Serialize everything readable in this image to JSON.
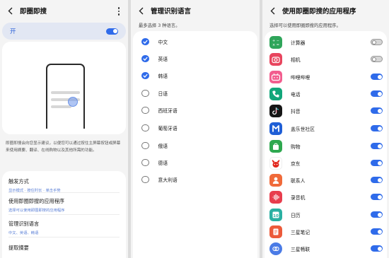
{
  "screen1": {
    "title": "即圈即搜",
    "master_toggle": {
      "label": "开",
      "on": true
    },
    "description": "即圈即搜会向您显示建议，以便您可以通过按住主屏幕按钮或屏幕来使用摘要、翻译、在线购物以及其他所需的功能。",
    "settings": [
      {
        "title": "触发方式",
        "subtitle": "显示模式 · 按住时长 · 单击手势"
      },
      {
        "title": "使用即圈即搜的应用程序",
        "subtitle": "选择可以使用即圈即搜的应用程序"
      },
      {
        "title": "管理识别语言",
        "subtitle": "中文、英语、韩语"
      },
      {
        "title": "提取摘要",
        "subtitle": ""
      }
    ]
  },
  "screen2": {
    "title": "管理识别语言",
    "subtitle": "最多选择 3 种语言。",
    "languages": [
      {
        "label": "中文",
        "checked": true
      },
      {
        "label": "英语",
        "checked": true
      },
      {
        "label": "韩语",
        "checked": true
      },
      {
        "label": "日语",
        "checked": false
      },
      {
        "label": "西班牙语",
        "checked": false
      },
      {
        "label": "葡萄牙语",
        "checked": false
      },
      {
        "label": "俄语",
        "checked": false
      },
      {
        "label": "德语",
        "checked": false
      },
      {
        "label": "意大利语",
        "checked": false
      }
    ]
  },
  "screen3": {
    "title": "使用即圈即搜的应用程序",
    "subtitle": "选择可以使用即圈即搜的应用程序。",
    "apps": [
      {
        "label": "计算器",
        "enabled": false,
        "icon": "calculator-icon",
        "color": "#2fa55a"
      },
      {
        "label": "相机",
        "enabled": false,
        "icon": "camera-icon",
        "color": "#e8455e"
      },
      {
        "label": "哔哩哔哩",
        "enabled": true,
        "icon": "bilibili-icon",
        "color": "#f25d8e"
      },
      {
        "label": "电话",
        "enabled": true,
        "icon": "phone-icon",
        "color": "#12a67a"
      },
      {
        "label": "抖音",
        "enabled": true,
        "icon": "douyin-icon",
        "color": "#161616"
      },
      {
        "label": "盖乐世社区",
        "enabled": true,
        "icon": "members-icon",
        "color": "#1f5fd6"
      },
      {
        "label": "购物",
        "enabled": true,
        "icon": "shopping-icon",
        "color": "#2ea84f"
      },
      {
        "label": "京东",
        "enabled": true,
        "icon": "jd-icon",
        "color": "#e1251b"
      },
      {
        "label": "联系人",
        "enabled": true,
        "icon": "contacts-icon",
        "color": "#f06a3a"
      },
      {
        "label": "录音机",
        "enabled": true,
        "icon": "recorder-icon",
        "color": "#e83d4d"
      },
      {
        "label": "日历",
        "enabled": true,
        "icon": "calendar-icon",
        "color": "#2ab0a2"
      },
      {
        "label": "三星笔记",
        "enabled": true,
        "icon": "notes-icon",
        "color": "#ec5a3a"
      },
      {
        "label": "三星畅联",
        "enabled": true,
        "icon": "continuity-icon",
        "color": "#4a7be6"
      }
    ]
  },
  "colors": {
    "accent": "#2f6bea",
    "toggle_off": "#d6d6d6",
    "background": "#f4f4f4",
    "card": "#ffffff"
  }
}
